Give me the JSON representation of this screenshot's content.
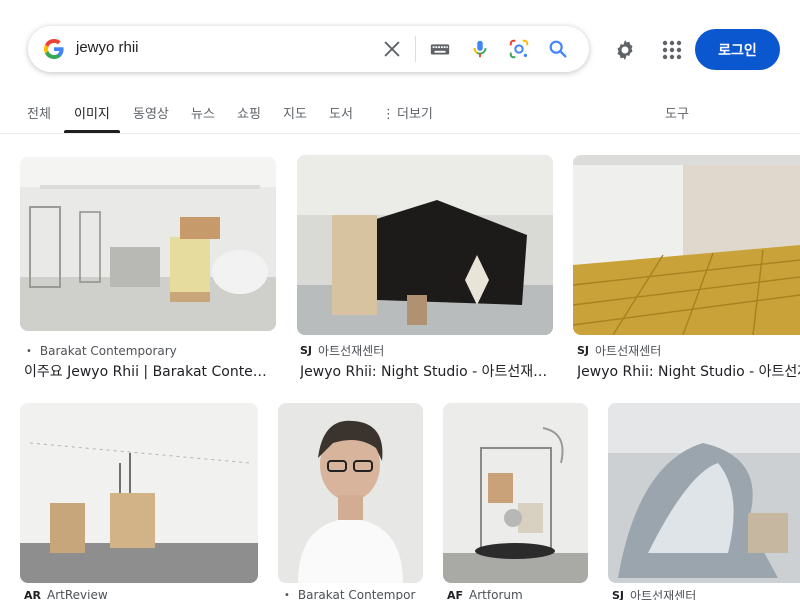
{
  "search": {
    "query": "jewyo rhii"
  },
  "header": {
    "login_label": "로그인"
  },
  "tabs": [
    {
      "label": "전체"
    },
    {
      "label": "이미지"
    },
    {
      "label": "동영상"
    },
    {
      "label": "뉴스"
    },
    {
      "label": "쇼핑"
    },
    {
      "label": "지도"
    },
    {
      "label": "도서"
    },
    {
      "label": "더보기"
    },
    {
      "label": "도구"
    }
  ],
  "results": [
    {
      "source_badge": "•",
      "source": "Barakat Contemporary",
      "title": "이주요 Jewyo Rhii | Barakat Contemporary"
    },
    {
      "source_badge": "SJ",
      "source": "아트선재센터",
      "title": "Jewyo Rhii: Night Studio - 아트선재센터"
    },
    {
      "source_badge": "SJ",
      "source": "아트선재센터",
      "title": "Jewyo Rhii: Night Studio - 아트선재센터"
    },
    {
      "source_badge": "AR",
      "source": "ArtReview",
      "title": ""
    },
    {
      "source_badge": "•",
      "source": "Barakat Contempor",
      "title": ""
    },
    {
      "source_badge": "AF",
      "source": "Artforum",
      "title": ""
    },
    {
      "source_badge": "SJ",
      "source": "아트선재센터",
      "title": ""
    }
  ]
}
